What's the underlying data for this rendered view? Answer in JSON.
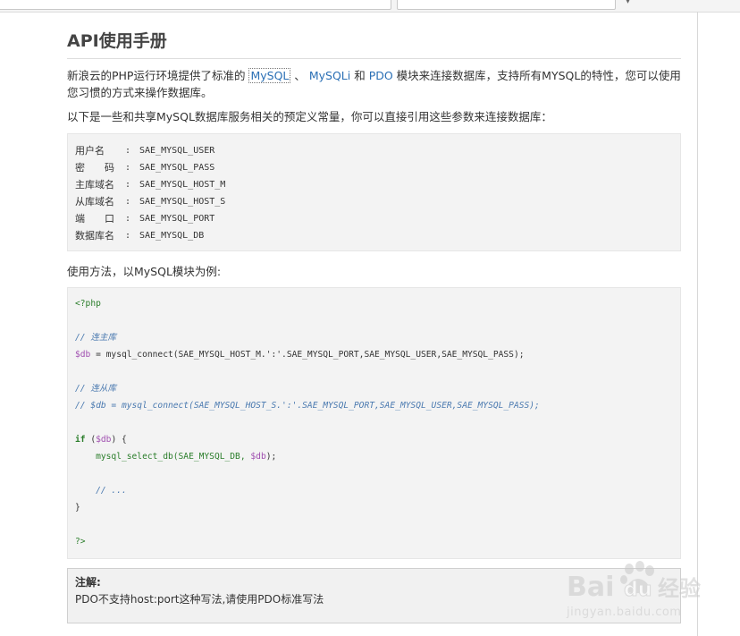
{
  "page": {
    "title": "API使用手册",
    "intro_prefix": "新浪云的PHP运行环境提供了标准的 ",
    "link_mysql": "MySQL",
    "intro_sep": " 、 ",
    "link_mysqli": "MySQLi",
    "intro_and": " 和 ",
    "link_pdo": "PDO",
    "intro_suffix": " 模块来连接数据库，支持所有MYSQL的特性，您可以使用您习惯的方式来操作数据库。",
    "intro2": "以下是一些和共享MySQL数据库服务相关的预定义常量，你可以直接引用这些参数来连接数据库：",
    "usage": "使用方法，以MySQL模块为例:"
  },
  "constants": [
    {
      "key": "用户名",
      "sep": ":",
      "value": "SAE_MYSQL_USER"
    },
    {
      "key": "密　　码",
      "sep": ":",
      "value": "SAE_MYSQL_PASS"
    },
    {
      "key": "主库域名",
      "sep": ":",
      "value": "SAE_MYSQL_HOST_M"
    },
    {
      "key": "从库域名",
      "sep": ":",
      "value": "SAE_MYSQL_HOST_S"
    },
    {
      "key": "端　　口",
      "sep": ":",
      "value": "SAE_MYSQL_PORT"
    },
    {
      "key": "数据库名",
      "sep": ":",
      "value": "SAE_MYSQL_DB"
    }
  ],
  "code": {
    "open_tag": "<?php",
    "comment_master": "// 连主库",
    "db_var": "$db",
    "assign": " = ",
    "connect_master": "mysql_connect(SAE_MYSQL_HOST_M.':'.SAE_MYSQL_PORT,SAE_MYSQL_USER,SAE_MYSQL_PASS);",
    "comment_slave": "// 连从库",
    "connect_slave": "// $db = mysql_connect(SAE_MYSQL_HOST_S.':'.SAE_MYSQL_PORT,SAE_MYSQL_USER,SAE_MYSQL_PASS);",
    "if_kw": "if",
    "if_open": " (",
    "if_var": "$db",
    "if_close": ") {",
    "select_db_fn": "    mysql_select_db(SAE_MYSQL_DB, ",
    "select_db_var": "$db",
    "select_db_end": ");",
    "ellipsis": "    // ...",
    "close_brace": "}",
    "close_tag": "?>"
  },
  "note": {
    "title": "注解:",
    "text": "PDO不支持host:port这种写法,请使用PDO标准写法"
  },
  "watermark": {
    "brand": "Bai",
    "du": "du",
    "product": "经验",
    "url": "jingyan.baidu.com"
  },
  "colors": {
    "link": "#2a6fb5",
    "code_green": "#2a7d2a",
    "code_comment": "#4b7ab0",
    "code_var": "#a04fb0"
  }
}
